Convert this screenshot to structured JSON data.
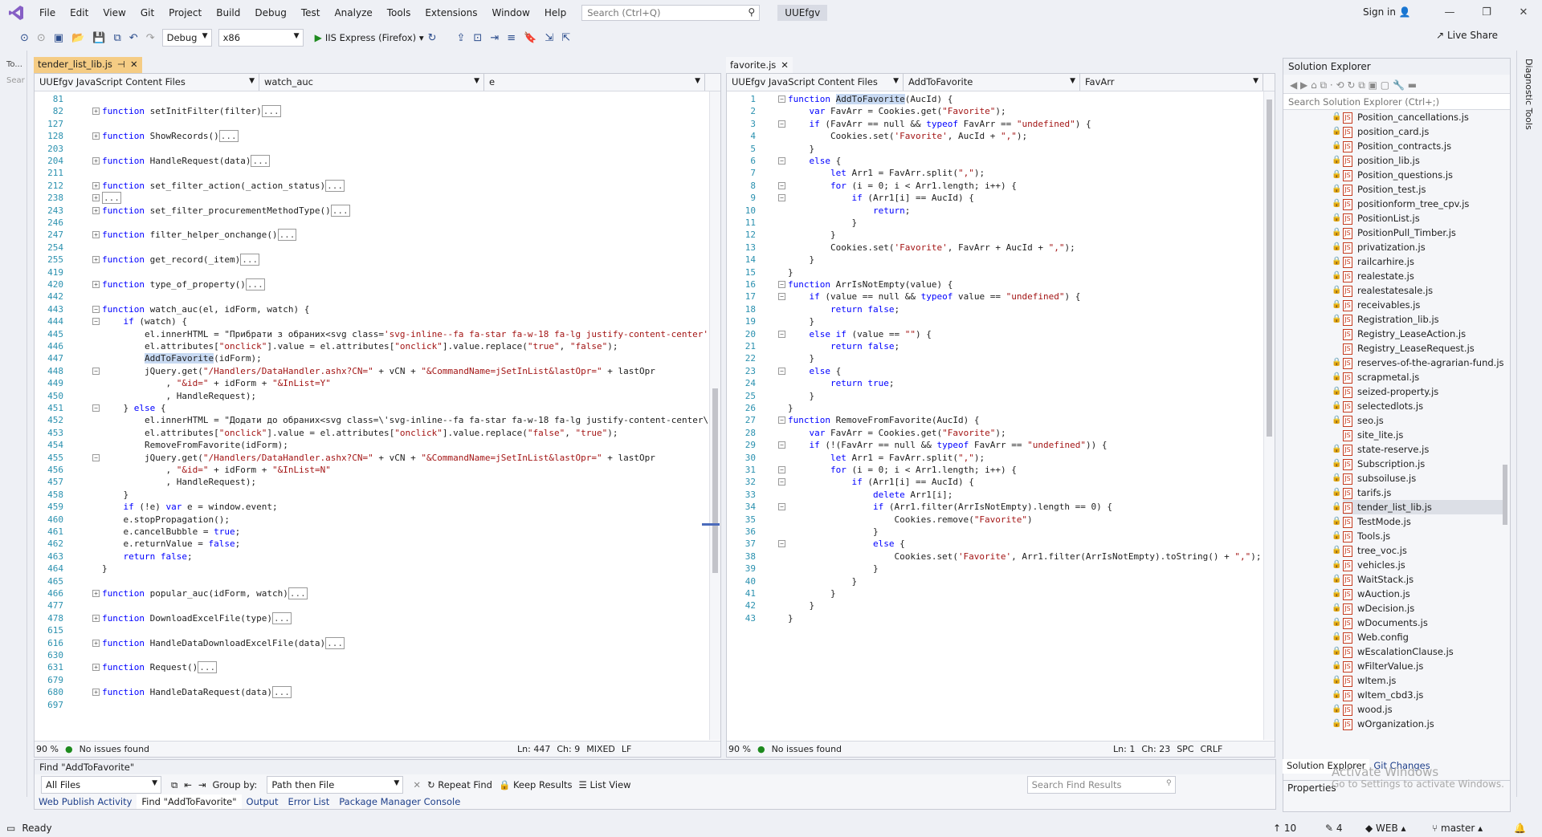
{
  "menu": [
    "File",
    "Edit",
    "View",
    "Git",
    "Project",
    "Build",
    "Debug",
    "Test",
    "Analyze",
    "Tools",
    "Extensions",
    "Window",
    "Help"
  ],
  "search": {
    "placeholder": "Search (Ctrl+Q)"
  },
  "solution_badge": "UUEfgv",
  "sign_in": "Sign in",
  "live_share": "Live Share",
  "toolbar": {
    "config": "Debug",
    "platform": "x86",
    "run": "IIS Express (Firefox)"
  },
  "left_strip_tabs": [
    "To...",
    "Sear"
  ],
  "left_editor": {
    "tab_label": "tender_list_lib.js",
    "nav_project": "UUEfgv JavaScript Content Files",
    "nav_scope": "watch_auc",
    "nav_member": "e",
    "zoom": "90 %",
    "issues": "No issues found",
    "ln": "Ln: 447",
    "ch": "Ch: 9",
    "eol_mode": "MIXED",
    "eol": "LF",
    "lines": [
      {
        "n": "81",
        "t": "",
        "fold": ""
      },
      {
        "n": "82",
        "t": "function setInitFilter(filter)",
        "fold": "+",
        "tail": "..."
      },
      {
        "n": "127",
        "t": "",
        "fold": ""
      },
      {
        "n": "128",
        "t": "function ShowRecords()",
        "fold": "+",
        "tail": "..."
      },
      {
        "n": "203",
        "t": "",
        "fold": ""
      },
      {
        "n": "204",
        "t": "function HandleRequest(data)",
        "fold": "+",
        "tail": "..."
      },
      {
        "n": "211",
        "t": "",
        "fold": ""
      },
      {
        "n": "212",
        "t": "function set_filter_action(_action_status)",
        "fold": "+",
        "tail": "..."
      },
      {
        "n": "238",
        "t": "",
        "fold": "+",
        "tail": "..."
      },
      {
        "n": "243",
        "t": "function set_filter_procurementMethodType()",
        "fold": "+",
        "tail": "..."
      },
      {
        "n": "246",
        "t": "",
        "fold": ""
      },
      {
        "n": "247",
        "t": "function filter_helper_onchange()",
        "fold": "+",
        "tail": "..."
      },
      {
        "n": "254",
        "t": "",
        "fold": ""
      },
      {
        "n": "255",
        "t": "function get_record(_item)",
        "fold": "+",
        "tail": "..."
      },
      {
        "n": "419",
        "t": "",
        "fold": ""
      },
      {
        "n": "420",
        "t": "function type_of_property()",
        "fold": "+",
        "tail": "..."
      },
      {
        "n": "442",
        "t": "",
        "fold": ""
      },
      {
        "n": "443",
        "t": "function watch_auc(el, idForm, watch) {",
        "fold": "-"
      },
      {
        "n": "444",
        "t": "    if (watch) {",
        "fold": "-"
      },
      {
        "n": "445",
        "t": "        el.innerHTML = \"Прибрати з обраних<svg class='svg-inline--fa fa-star fa-w-18 fa-lg justify-content-center' st",
        "fold": ""
      },
      {
        "n": "446",
        "t": "        el.attributes[\"onclick\"].value = el.attributes[\"onclick\"].value.replace(\"true\", \"false\");",
        "fold": ""
      },
      {
        "n": "447",
        "t": "        AddToFavorite(idForm);",
        "fold": "",
        "hl": "AddToFavorite"
      },
      {
        "n": "448",
        "t": "        jQuery.get(\"/Handlers/DataHandler.ashx?CN=\" + vCN + \"&CommandName=jSetInList&lastOpr=\" + lastOpr",
        "fold": "-"
      },
      {
        "n": "449",
        "t": "            , \"&id=\" + idForm + \"&InList=Y\"",
        "fold": ""
      },
      {
        "n": "450",
        "t": "            , HandleRequest);",
        "fold": ""
      },
      {
        "n": "451",
        "t": "    } else {",
        "fold": "-"
      },
      {
        "n": "452",
        "t": "        el.innerHTML = \"Додати до обраних<svg class=\\'svg-inline--fa fa-star fa-w-18 fa-lg justify-content-center\\' s",
        "fold": ""
      },
      {
        "n": "453",
        "t": "        el.attributes[\"onclick\"].value = el.attributes[\"onclick\"].value.replace(\"false\", \"true\");",
        "fold": ""
      },
      {
        "n": "454",
        "t": "        RemoveFromFavorite(idForm);",
        "fold": ""
      },
      {
        "n": "455",
        "t": "        jQuery.get(\"/Handlers/DataHandler.ashx?CN=\" + vCN + \"&CommandName=jSetInList&lastOpr=\" + lastOpr",
        "fold": "-"
      },
      {
        "n": "456",
        "t": "            , \"&id=\" + idForm + \"&InList=N\"",
        "fold": ""
      },
      {
        "n": "457",
        "t": "            , HandleRequest);",
        "fold": ""
      },
      {
        "n": "458",
        "t": "    }",
        "fold": ""
      },
      {
        "n": "459",
        "t": "    if (!e) var e = window.event;",
        "fold": ""
      },
      {
        "n": "460",
        "t": "    e.stopPropagation();",
        "fold": ""
      },
      {
        "n": "461",
        "t": "    e.cancelBubble = true;",
        "fold": ""
      },
      {
        "n": "462",
        "t": "    e.returnValue = false;",
        "fold": ""
      },
      {
        "n": "463",
        "t": "    return false;",
        "fold": ""
      },
      {
        "n": "464",
        "t": "}",
        "fold": ""
      },
      {
        "n": "465",
        "t": "",
        "fold": ""
      },
      {
        "n": "466",
        "t": "function popular_auc(idForm, watch)",
        "fold": "+",
        "tail": "..."
      },
      {
        "n": "477",
        "t": "",
        "fold": ""
      },
      {
        "n": "478",
        "t": "function DownloadExcelFile(type)",
        "fold": "+",
        "tail": "..."
      },
      {
        "n": "615",
        "t": "",
        "fold": ""
      },
      {
        "n": "616",
        "t": "function HandleDataDownloadExcelFile(data)",
        "fold": "+",
        "tail": "..."
      },
      {
        "n": "630",
        "t": "",
        "fold": ""
      },
      {
        "n": "631",
        "t": "function Request()",
        "fold": "+",
        "tail": "..."
      },
      {
        "n": "679",
        "t": "",
        "fold": ""
      },
      {
        "n": "680",
        "t": "function HandleDataRequest(data)",
        "fold": "+",
        "tail": "..."
      },
      {
        "n": "697",
        "t": "",
        "fold": ""
      }
    ]
  },
  "right_editor": {
    "tab_label": "favorite.js",
    "nav_project": "UUEfgv JavaScript Content Files",
    "nav_scope": "AddToFavorite",
    "nav_member": "FavArr",
    "zoom": "90 %",
    "issues": "No issues found",
    "ln": "Ln: 1",
    "ch": "Ch: 23",
    "eol_mode": "SPC",
    "eol": "CRLF",
    "lines": [
      {
        "n": "1",
        "t": "function AddToFavorite(AucId) {",
        "fold": "-",
        "hl": "AddToFavorite(AucId)"
      },
      {
        "n": "2",
        "t": "    var FavArr = Cookies.get(\"Favorite\");",
        "fold": ""
      },
      {
        "n": "3",
        "t": "    if (FavArr == null && typeof FavArr == \"undefined\") {",
        "fold": "-"
      },
      {
        "n": "4",
        "t": "        Cookies.set('Favorite', AucId + \",\");",
        "fold": ""
      },
      {
        "n": "5",
        "t": "    }",
        "fold": ""
      },
      {
        "n": "6",
        "t": "    else {",
        "fold": "-"
      },
      {
        "n": "7",
        "t": "        let Arr1 = FavArr.split(\",\");",
        "fold": ""
      },
      {
        "n": "8",
        "t": "        for (i = 0; i < Arr1.length; i++) {",
        "fold": "-"
      },
      {
        "n": "9",
        "t": "            if (Arr1[i] == AucId) {",
        "fold": "-"
      },
      {
        "n": "10",
        "t": "                return;",
        "fold": ""
      },
      {
        "n": "11",
        "t": "            }",
        "fold": ""
      },
      {
        "n": "12",
        "t": "        }",
        "fold": ""
      },
      {
        "n": "13",
        "t": "        Cookies.set('Favorite', FavArr + AucId + \",\");",
        "fold": ""
      },
      {
        "n": "14",
        "t": "    }",
        "fold": ""
      },
      {
        "n": "15",
        "t": "}",
        "fold": ""
      },
      {
        "n": "16",
        "t": "function ArrIsNotEmpty(value) {",
        "fold": "-"
      },
      {
        "n": "17",
        "t": "    if (value == null && typeof value == \"undefined\") {",
        "fold": "-"
      },
      {
        "n": "18",
        "t": "        return false;",
        "fold": ""
      },
      {
        "n": "19",
        "t": "    }",
        "fold": ""
      },
      {
        "n": "20",
        "t": "    else if (value == \"\") {",
        "fold": "-"
      },
      {
        "n": "21",
        "t": "        return false;",
        "fold": ""
      },
      {
        "n": "22",
        "t": "    }",
        "fold": ""
      },
      {
        "n": "23",
        "t": "    else {",
        "fold": "-"
      },
      {
        "n": "24",
        "t": "        return true;",
        "fold": ""
      },
      {
        "n": "25",
        "t": "    }",
        "fold": ""
      },
      {
        "n": "26",
        "t": "}",
        "fold": ""
      },
      {
        "n": "27",
        "t": "function RemoveFromFavorite(AucId) {",
        "fold": "-"
      },
      {
        "n": "28",
        "t": "    var FavArr = Cookies.get(\"Favorite\");",
        "fold": ""
      },
      {
        "n": "29",
        "t": "    if (!(FavArr == null && typeof FavArr == \"undefined\")) {",
        "fold": "-"
      },
      {
        "n": "30",
        "t": "        let Arr1 = FavArr.split(\",\");",
        "fold": ""
      },
      {
        "n": "31",
        "t": "        for (i = 0; i < Arr1.length; i++) {",
        "fold": "-"
      },
      {
        "n": "32",
        "t": "            if (Arr1[i] == AucId) {",
        "fold": "-"
      },
      {
        "n": "33",
        "t": "                delete Arr1[i];",
        "fold": ""
      },
      {
        "n": "34",
        "t": "                if (Arr1.filter(ArrIsNotEmpty).length == 0) {",
        "fold": "-"
      },
      {
        "n": "35",
        "t": "                    Cookies.remove(\"Favorite\")",
        "fold": ""
      },
      {
        "n": "36",
        "t": "                }",
        "fold": ""
      },
      {
        "n": "37",
        "t": "                else {",
        "fold": "-"
      },
      {
        "n": "38",
        "t": "                    Cookies.set('Favorite', Arr1.filter(ArrIsNotEmpty).toString() + \",\");",
        "fold": ""
      },
      {
        "n": "39",
        "t": "                }",
        "fold": ""
      },
      {
        "n": "40",
        "t": "            }",
        "fold": ""
      },
      {
        "n": "41",
        "t": "        }",
        "fold": ""
      },
      {
        "n": "42",
        "t": "    }",
        "fold": ""
      },
      {
        "n": "43",
        "t": "}",
        "fold": ""
      }
    ]
  },
  "solution_explorer": {
    "title": "Solution Explorer",
    "search_placeholder": "Search Solution Explorer (Ctrl+;)",
    "items": [
      {
        "name": "Position_cancellations.js",
        "lock": true
      },
      {
        "name": "position_card.js",
        "lock": true
      },
      {
        "name": "Position_contracts.js",
        "lock": true
      },
      {
        "name": "position_lib.js",
        "lock": true
      },
      {
        "name": "Position_questions.js",
        "lock": true
      },
      {
        "name": "Position_test.js",
        "lock": true
      },
      {
        "name": "positionform_tree_cpv.js",
        "lock": true
      },
      {
        "name": "PositionList.js",
        "lock": true
      },
      {
        "name": "PositionPull_Timber.js",
        "lock": true
      },
      {
        "name": "privatization.js",
        "lock": true
      },
      {
        "name": "railcarhire.js",
        "lock": true
      },
      {
        "name": "realestate.js",
        "lock": true
      },
      {
        "name": "realestatesale.js",
        "lock": true
      },
      {
        "name": "receivables.js",
        "lock": true
      },
      {
        "name": "Registration_lib.js",
        "lock": true
      },
      {
        "name": "Registry_LeaseAction.js",
        "lock": false
      },
      {
        "name": "Registry_LeaseRequest.js",
        "lock": false
      },
      {
        "name": "reserves-of-the-agrarian-fund.js",
        "lock": true
      },
      {
        "name": "scrapmetal.js",
        "lock": true
      },
      {
        "name": "seized-property.js",
        "lock": true
      },
      {
        "name": "selectedlots.js",
        "lock": true
      },
      {
        "name": "seo.js",
        "lock": true
      },
      {
        "name": "site_lite.js",
        "lock": false
      },
      {
        "name": "state-reserve.js",
        "lock": true
      },
      {
        "name": "Subscription.js",
        "lock": true
      },
      {
        "name": "subsoiluse.js",
        "lock": true
      },
      {
        "name": "tarifs.js",
        "lock": true
      },
      {
        "name": "tender_list_lib.js",
        "lock": true,
        "selected": true
      },
      {
        "name": "TestMode.js",
        "lock": true
      },
      {
        "name": "Tools.js",
        "lock": true
      },
      {
        "name": "tree_voc.js",
        "lock": true
      },
      {
        "name": "vehicles.js",
        "lock": true
      },
      {
        "name": "WaitStack.js",
        "lock": true
      },
      {
        "name": "wAuction.js",
        "lock": true
      },
      {
        "name": "wDecision.js",
        "lock": true
      },
      {
        "name": "wDocuments.js",
        "lock": true
      },
      {
        "name": "Web.config",
        "lock": true
      },
      {
        "name": "wEscalationClause.js",
        "lock": true
      },
      {
        "name": "wFilterValue.js",
        "lock": true
      },
      {
        "name": "wItem.js",
        "lock": true
      },
      {
        "name": "wItem_cbd3.js",
        "lock": true
      },
      {
        "name": "wood.js",
        "lock": true
      },
      {
        "name": "wOrganization.js",
        "lock": true
      }
    ],
    "bottom_tabs": [
      "Solution Explorer",
      "Git Changes"
    ],
    "properties": "Properties",
    "watermark": "Activate Windows",
    "watermark2": "Go to Settings to activate Windows."
  },
  "find": {
    "title": "Find \"AddToFavorite\"",
    "scope": "All Files",
    "group_by_label": "Group by:",
    "group_by_value": "Path then File",
    "repeat": "Repeat Find",
    "keep": "Keep Results",
    "list": "List View",
    "search_placeholder": "Search Find Results"
  },
  "bottom_tabs": [
    "Web Publish Activity",
    "Find \"AddToFavorite\"",
    "Output",
    "Error List",
    "Package Manager Console"
  ],
  "status": {
    "ready": "Ready",
    "up": "10",
    "pencil": "4",
    "web": "WEB",
    "branch": "master"
  },
  "right_strip": [
    "Diagnostic Tools"
  ]
}
